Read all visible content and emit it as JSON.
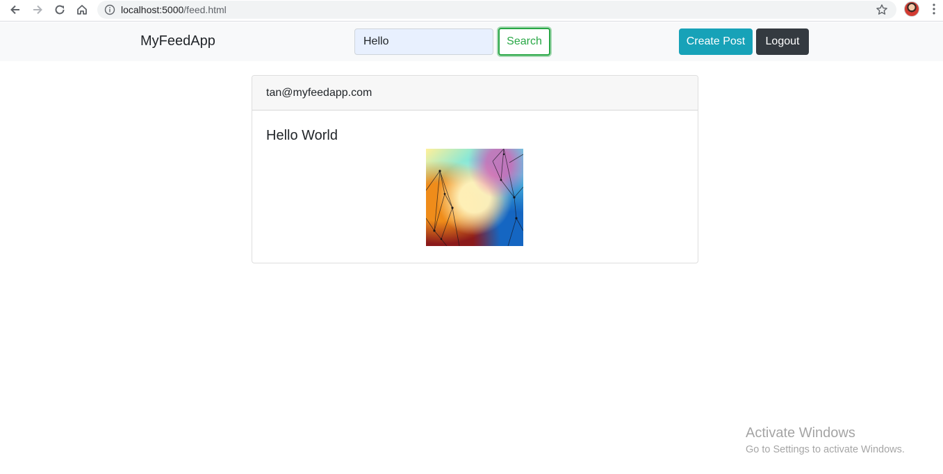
{
  "browser": {
    "url_host": "localhost:5000",
    "url_path": "/feed.html",
    "icons": [
      "back-icon",
      "forward-icon",
      "reload-icon",
      "home-icon",
      "info-icon",
      "star-icon",
      "avatar",
      "menu-icon"
    ]
  },
  "navbar": {
    "brand": "MyFeedApp",
    "search_value": "Hello",
    "search_button": "Search",
    "create_post_button": "Create Post",
    "logout_button": "Logout",
    "colors": {
      "navbar_bg": "#f8f9fa",
      "search_accent": "#28a745",
      "create_post_bg": "#17a2b8",
      "logout_bg": "#343a40"
    }
  },
  "feed": {
    "posts": [
      {
        "author": "tan@myfeedapp.com",
        "text": "Hello World",
        "image": "abstract-gradient-network-image"
      }
    ]
  },
  "watermark": {
    "title": "Activate Windows",
    "subtitle": "Go to Settings to activate Windows."
  }
}
